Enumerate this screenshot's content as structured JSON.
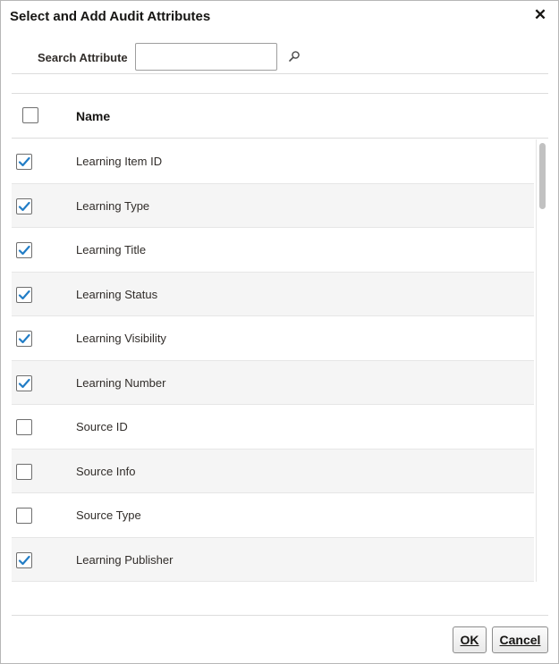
{
  "dialog": {
    "title": "Select and Add Audit Attributes",
    "close_glyph": "✕"
  },
  "search": {
    "label": "Search Attribute",
    "value": "",
    "placeholder": "",
    "icon": "search-icon"
  },
  "table": {
    "header_name": "Name",
    "select_all_checked": false,
    "rows": [
      {
        "name": "Learning Item ID",
        "checked": true
      },
      {
        "name": "Learning Type",
        "checked": true
      },
      {
        "name": "Learning Title",
        "checked": true
      },
      {
        "name": "Learning Status",
        "checked": true
      },
      {
        "name": "Learning Visibility",
        "checked": true
      },
      {
        "name": "Learning Number",
        "checked": true
      },
      {
        "name": "Source ID",
        "checked": false
      },
      {
        "name": "Source Info",
        "checked": false
      },
      {
        "name": "Source Type",
        "checked": false
      },
      {
        "name": "Learning Publisher",
        "checked": true
      }
    ]
  },
  "buttons": {
    "ok_label": "OK",
    "cancel_label": "Cancel"
  },
  "colors": {
    "check_accent": "#227dc6",
    "row_alt": "#f5f5f5"
  }
}
